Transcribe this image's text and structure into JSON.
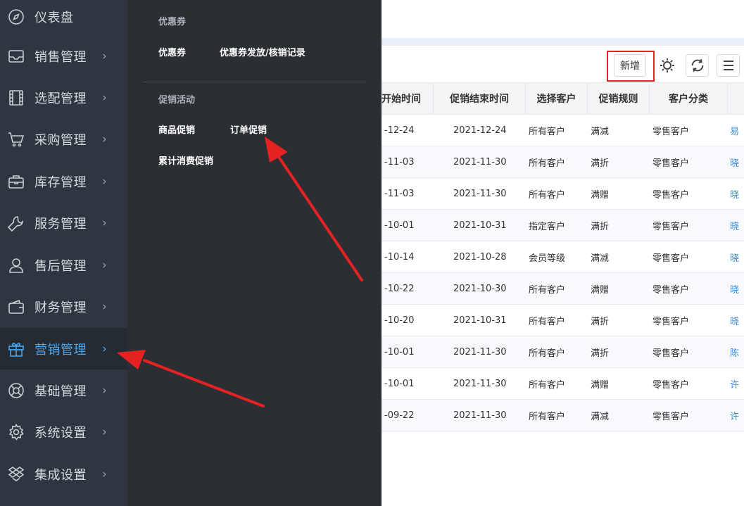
{
  "sidebar": {
    "items": [
      {
        "label": "仪表盘",
        "icon": "compass-icon",
        "chevron": ""
      },
      {
        "label": "销售管理",
        "icon": "inbox-icon",
        "chevron": "›"
      },
      {
        "label": "选配管理",
        "icon": "film-icon",
        "chevron": "›"
      },
      {
        "label": "采购管理",
        "icon": "cart-icon",
        "chevron": "›"
      },
      {
        "label": "库存管理",
        "icon": "briefcase-icon",
        "chevron": "›"
      },
      {
        "label": "服务管理",
        "icon": "wrench-icon",
        "chevron": "›"
      },
      {
        "label": "售后管理",
        "icon": "user-icon",
        "chevron": "›"
      },
      {
        "label": "财务管理",
        "icon": "wallet-icon",
        "chevron": "›"
      },
      {
        "label": "营销管理",
        "icon": "gift-icon",
        "chevron": "›",
        "active": true
      },
      {
        "label": "基础管理",
        "icon": "lifebuoy-icon",
        "chevron": "›"
      },
      {
        "label": "系统设置",
        "icon": "gear-icon",
        "chevron": "›"
      },
      {
        "label": "集成设置",
        "icon": "dropbox-icon",
        "chevron": "›"
      }
    ]
  },
  "flyout": {
    "groups": [
      {
        "title": "优惠券",
        "links": [
          "优惠券",
          "优惠券发放/核销记录"
        ]
      },
      {
        "title": "促销活动",
        "links": [
          "商品促销",
          "订单促销",
          "累计消费促销"
        ]
      }
    ]
  },
  "toolbar": {
    "add_label": "新增",
    "settings_icon": "gear-icon",
    "refresh_icon": "refresh-icon",
    "menu_icon": "menu-icon"
  },
  "table": {
    "columns": [
      "开始时间",
      "促销结束时间",
      "选择客户",
      "促销规则",
      "客户分类",
      ""
    ],
    "rows": [
      [
        "-12-24",
        "2021-12-24",
        "所有客户",
        "满减",
        "零售客户",
        "易"
      ],
      [
        "-11-03",
        "2021-11-30",
        "所有客户",
        "满折",
        "零售客户",
        "晓"
      ],
      [
        "-11-03",
        "2021-11-30",
        "所有客户",
        "满赠",
        "零售客户",
        "晓"
      ],
      [
        "-10-01",
        "2021-10-31",
        "指定客户",
        "满折",
        "零售客户",
        "晓"
      ],
      [
        "-10-14",
        "2021-10-28",
        "会员等级",
        "满减",
        "零售客户",
        "晓"
      ],
      [
        "-10-22",
        "2021-10-30",
        "所有客户",
        "满赠",
        "零售客户",
        "晓"
      ],
      [
        "-10-20",
        "2021-10-31",
        "所有客户",
        "满折",
        "零售客户",
        "晓"
      ],
      [
        "-10-01",
        "2021-11-30",
        "所有客户",
        "满折",
        "零售客户",
        "陈"
      ],
      [
        "-10-01",
        "2021-11-30",
        "所有客户",
        "满赠",
        "零售客户",
        "许"
      ],
      [
        "-09-22",
        "2021-11-30",
        "所有客户",
        "满减",
        "零售客户",
        "许"
      ]
    ]
  },
  "colors": {
    "sidebar_bg": "#2f3640",
    "flyout_bg": "#2b2e33",
    "active_accent": "#4aa5f0",
    "annotation_red": "#e52222",
    "link_blue": "#3d8fd6"
  }
}
